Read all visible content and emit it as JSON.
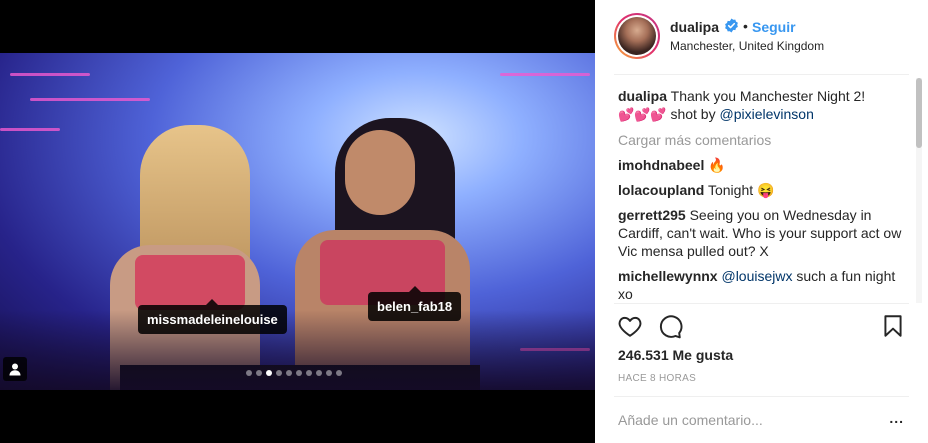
{
  "post": {
    "tags": [
      "missmadeleinelouise",
      "belen_fab18"
    ],
    "carousel": {
      "total": 10,
      "active_index": 2
    }
  },
  "header": {
    "username": "dualipa",
    "separator": "•",
    "follow_label": "Seguir",
    "location": "Manchester, United Kingdom"
  },
  "caption": {
    "username": "dualipa",
    "text": "Thank you Manchester Night 2!",
    "emoji": "💕💕💕",
    "text2": "shot by",
    "mention": "@pixielevinson"
  },
  "load_more_label": "Cargar más comentarios",
  "comments": [
    {
      "user": "imohdnabeel",
      "text": "🔥"
    },
    {
      "user": "lolacoupland",
      "text": "Tonight 😝"
    },
    {
      "user": "gerrett295",
      "text": "Seeing you on Wednesday in Cardiff, can't wait. Who is your support act ow Vic mensa pulled out? X"
    },
    {
      "user": "michellewynnx",
      "mention": "@louisejwx",
      "text": "such a fun night xo"
    }
  ],
  "likes": "246.531 Me gusta",
  "time": "HACE 8 HORAS",
  "add_comment_placeholder": "Añade un comentario...",
  "more_label": "...",
  "colors": {
    "link": "#3897f0",
    "mention": "#003569",
    "muted": "#999999",
    "text": "#262626"
  }
}
